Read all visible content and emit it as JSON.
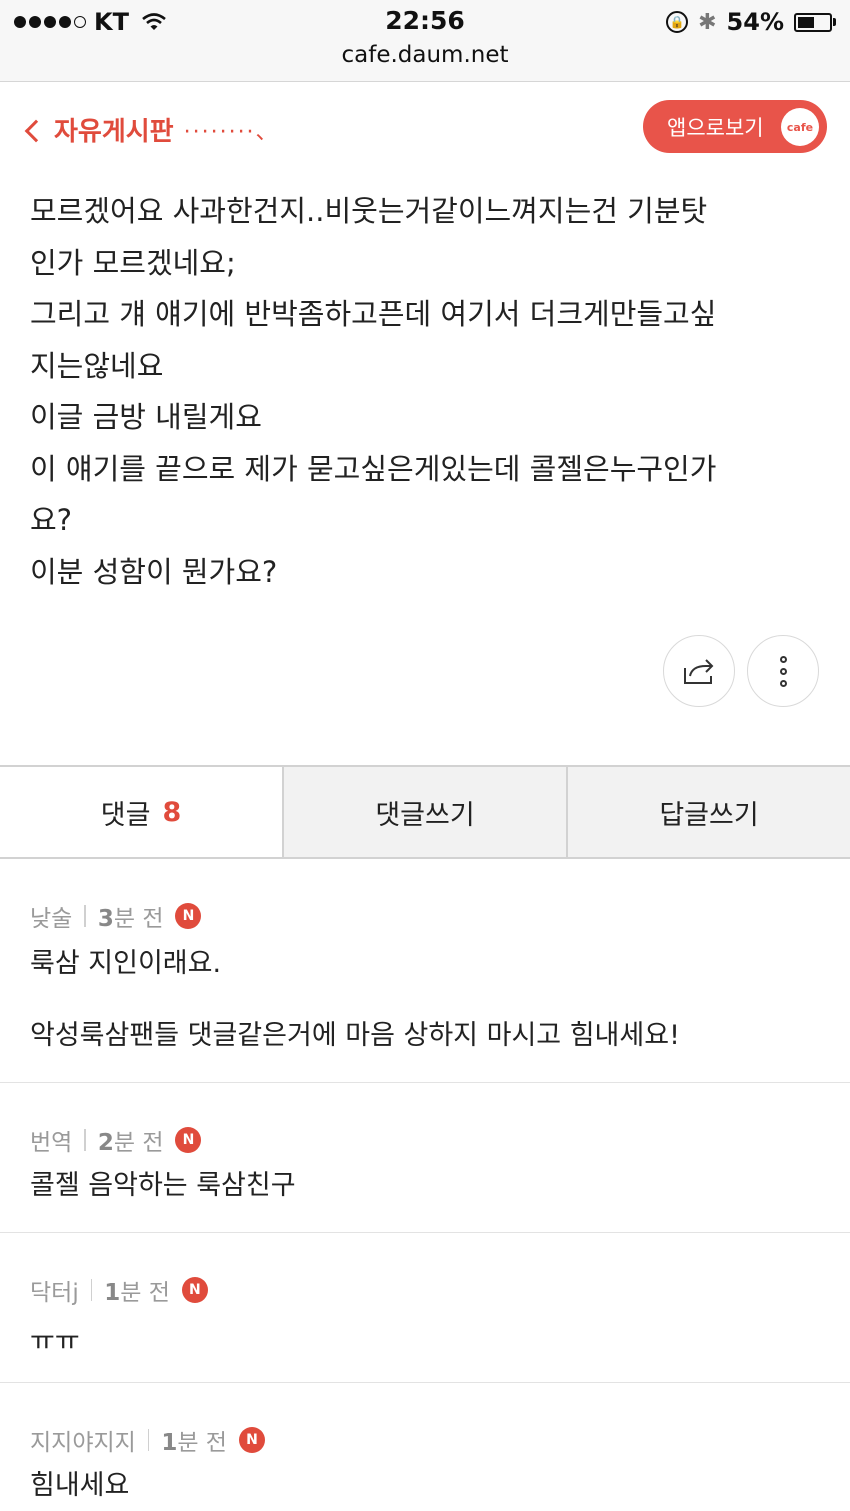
{
  "status_bar": {
    "carrier": "KT",
    "time": "22:56",
    "url": "cafe.daum.net",
    "battery": "54%"
  },
  "header": {
    "back_label": "자유게시판",
    "trail": "········、",
    "app_button_label": "앱으로보기",
    "app_badge": "cafe"
  },
  "post": {
    "lines": [
      "모르겠어요 사과한건지..비웃는거같이느껴지는건 기분탓",
      "인가 모르겠네요;",
      "그리고 걔 얘기에 반박좀하고픈데 여기서 더크게만들고싶",
      "지는않네요",
      "이글 금방 내릴게요",
      "이 얘기를 끝으로 제가 묻고싶은게있는데 콜젤은누구인가",
      "요?",
      "이분 성함이 뭔가요?"
    ]
  },
  "tabs": {
    "comments_label": "댓글",
    "comments_count": "8",
    "write_comment_label": "댓글쓰기",
    "write_reply_label": "답글쓰기"
  },
  "comments": [
    {
      "author": "낮술",
      "time_num": "3",
      "time_unit": "분 전",
      "badge": "N",
      "text": "룩삼 지인이래요.",
      "text2": "악성룩삼팬들 댓글같은거에 마음 상하지 마시고 힘내세요!"
    },
    {
      "author": "번역",
      "time_num": "2",
      "time_unit": "분 전",
      "badge": "N",
      "text": "콜젤 음악하는 룩삼친구"
    },
    {
      "author": "닥터j",
      "time_num": "1",
      "time_unit": "분 전",
      "badge": "N",
      "text": "ㅠㅠ"
    },
    {
      "author": "지지야지지",
      "time_num": "1",
      "time_unit": "분 전",
      "badge": "N",
      "text": "힘내세요"
    }
  ]
}
